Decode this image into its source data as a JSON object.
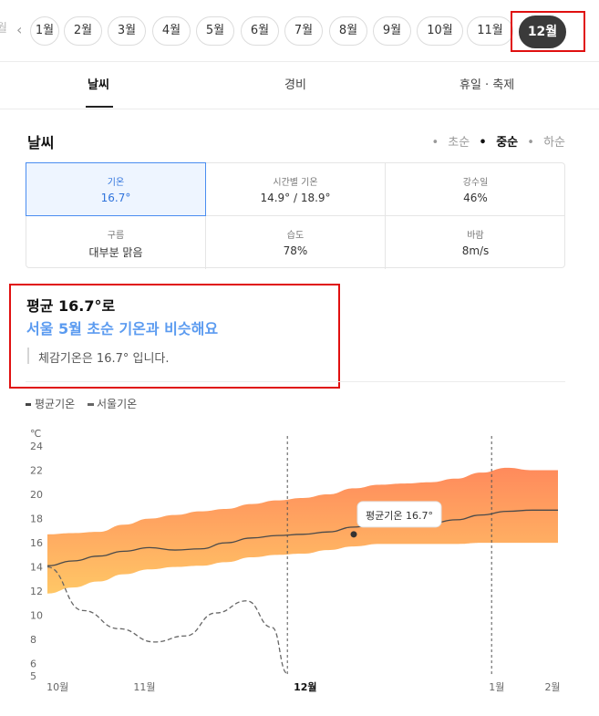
{
  "months": {
    "edge_label": "월",
    "prev_label": "‹",
    "items": [
      "1월",
      "2월",
      "3월",
      "4월",
      "5월",
      "6월",
      "7월",
      "8월",
      "9월",
      "10월",
      "11월",
      "12월"
    ],
    "selected": "12월"
  },
  "tabs": [
    {
      "label": "날씨",
      "active": true
    },
    {
      "label": "경비",
      "active": false
    },
    {
      "label": "휴일 · 축제",
      "active": false
    }
  ],
  "weather": {
    "title": "날씨",
    "periods": [
      {
        "label": "초순",
        "active": false
      },
      {
        "label": "중순",
        "active": true
      },
      {
        "label": "하순",
        "active": false
      }
    ],
    "stats": [
      {
        "label": "기온",
        "value": "16.7°",
        "selected": true
      },
      {
        "label": "시간별 기온",
        "value": "14.9° / 18.9°",
        "selected": false
      },
      {
        "label": "강수일",
        "value": "46%",
        "selected": false
      },
      {
        "label": "구름",
        "value": "대부분 맑음",
        "selected": false
      },
      {
        "label": "습도",
        "value": "78%",
        "selected": false
      },
      {
        "label": "바람",
        "value": "8m/s",
        "selected": false
      }
    ]
  },
  "summary": {
    "title": "평균 16.7°로",
    "compare": "서울 5월 초순 기온과 비슷해요",
    "feel": "체감기온은 16.7° 입니다."
  },
  "legend": {
    "avg": "평균기온",
    "seoul": "서울기온"
  },
  "colors": {
    "accent": "#5b9bf0",
    "selected_border": "#4a8df0",
    "band_top": "#ff8a5c",
    "band_bottom": "#ffc766",
    "highlight": "#e01010"
  },
  "chart_data": {
    "type": "area",
    "unit": "℃",
    "y_ticks": [
      5,
      6,
      8,
      10,
      12,
      14,
      16,
      18,
      20,
      22,
      24
    ],
    "ylim": [
      5,
      24
    ],
    "x_ticks": [
      "10월",
      "11월",
      "12월",
      "1월",
      "2월"
    ],
    "x_ticks_bold": "12월",
    "x": [
      0,
      0.5,
      1,
      1.5,
      2,
      2.5,
      3,
      3.5,
      4,
      4.5,
      5,
      5.5,
      6,
      6.5,
      7,
      7.5,
      8,
      8.5,
      9,
      9.5,
      10
    ],
    "series": [
      {
        "name": "평균기온",
        "style": "line",
        "values": [
          14.1,
          14.5,
          14.9,
          15.3,
          15.6,
          15.4,
          15.5,
          16.0,
          16.4,
          16.6,
          16.7,
          16.9,
          17.3,
          17.6,
          17.5,
          17.6,
          17.9,
          18.3,
          18.6,
          18.7,
          18.7
        ]
      },
      {
        "name": "평균기온 최고",
        "style": "band-top",
        "values": [
          16.7,
          16.8,
          16.9,
          17.5,
          18.0,
          18.3,
          18.6,
          18.8,
          19.2,
          19.5,
          19.7,
          20.0,
          20.5,
          20.8,
          20.9,
          21.0,
          21.3,
          21.8,
          22.2,
          22.0,
          22.0
        ]
      },
      {
        "name": "평균기온 최저",
        "style": "band-bottom",
        "values": [
          11.8,
          12.3,
          12.8,
          13.4,
          13.8,
          14.0,
          14.1,
          14.4,
          14.8,
          15.0,
          15.1,
          15.4,
          15.7,
          15.9,
          15.9,
          15.9,
          15.9,
          16.0,
          16.0,
          16.0,
          16.0
        ]
      },
      {
        "name": "서울기온",
        "style": "dashed",
        "values": [
          14.0,
          10.4,
          8.9,
          7.8,
          8.3,
          10.2,
          11.2,
          9.0,
          5.2
        ]
      }
    ],
    "seoul_x": [
      0,
      0.7,
      1.4,
      2.1,
      2.7,
      3.3,
      3.9,
      4.4,
      4.7
    ],
    "marker": {
      "x": 6.0,
      "value": 16.7,
      "label": "평균기온 16.7°"
    },
    "dashed_verticals": [
      4.7,
      8.7
    ]
  }
}
